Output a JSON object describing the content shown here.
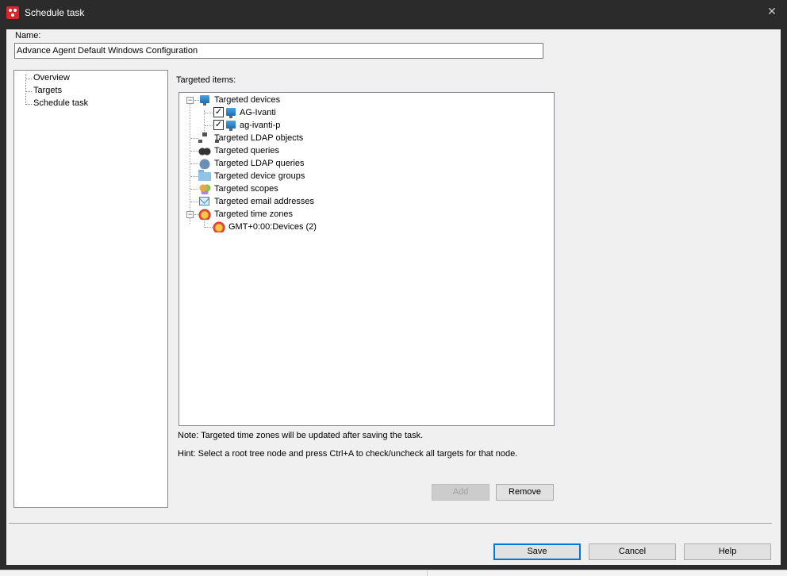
{
  "window": {
    "title": "Schedule task",
    "close_glyph": "✕"
  },
  "name": {
    "label": "Name:",
    "value": "Advance Agent Default Windows Configuration"
  },
  "nav": {
    "items": [
      "Overview",
      "Targets",
      "Schedule task"
    ]
  },
  "targets": {
    "label": "Targeted items:",
    "tree": {
      "devices": {
        "label": "Targeted devices",
        "icon": "monitor-icon",
        "children": [
          {
            "label": "AG-Ivanti",
            "checked": true
          },
          {
            "label": "ag-ivanti-p",
            "checked": true
          }
        ]
      },
      "ldap_objects": "Targeted LDAP objects",
      "queries": "Targeted queries",
      "ldap_queries": "Targeted LDAP queries",
      "device_groups": "Targeted device groups",
      "scopes": "Targeted scopes",
      "email_addresses": "Targeted email addresses",
      "time_zones": {
        "label": "Targeted time zones",
        "children": [
          "GMT+0:00:Devices (2)"
        ]
      }
    },
    "expanded_glyph": "−",
    "check_glyph": "✓"
  },
  "note": "Note: Targeted time zones will be updated after saving the task.",
  "hint": "Hint: Select a root tree node and press Ctrl+A to check/uncheck all targets for that node.",
  "buttons": {
    "add": "Add",
    "remove": "Remove",
    "save": "Save",
    "cancel": "Cancel",
    "help": "Help"
  },
  "colors": {
    "accent": "#0078d7",
    "titlebar": "#2b2b2b",
    "brand": "#d9272e"
  }
}
